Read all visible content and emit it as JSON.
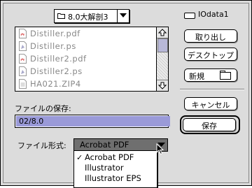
{
  "folder_popup": {
    "label": "8.0大解剖3",
    "icon": "folder-icon"
  },
  "file_list": {
    "items": [
      {
        "name": "Distiller.pdf",
        "icon": "pdf-document-icon"
      },
      {
        "name": "Distiller.ps",
        "icon": "postscript-document-icon"
      },
      {
        "name": "Distiller2.pdf",
        "icon": "pdf-document-icon"
      },
      {
        "name": "Distiller2.ps",
        "icon": "postscript-document-icon"
      },
      {
        "name": "HA021.ZIP4",
        "icon": "document-icon"
      }
    ]
  },
  "disk": {
    "label": "IOdata1",
    "icon": "disk-icon"
  },
  "buttons": {
    "eject": "取り出し",
    "desktop": "デスクトップ",
    "new": "新規",
    "cancel": "キャンセル",
    "save": "保存"
  },
  "save_as": {
    "label": "ファイルの保存:",
    "value": "02/8.0"
  },
  "format": {
    "label": "ファイル形式:",
    "selected": "Acrobat PDF",
    "options": [
      {
        "label": "Acrobat PDF",
        "checked": true
      },
      {
        "label": "Illustrator",
        "checked": false
      },
      {
        "label": "Illustrator EPS",
        "checked": false
      }
    ],
    "check_mark": "✓"
  },
  "colors": {
    "selection": "#9a9ad8",
    "dialog_bg": "#dcdcdc",
    "disabled_text": "#888888"
  }
}
